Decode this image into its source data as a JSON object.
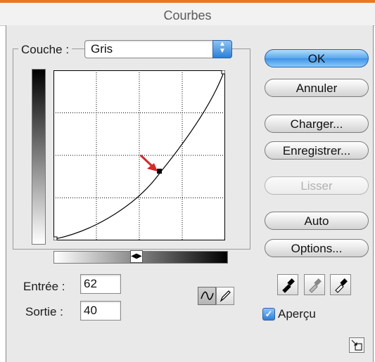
{
  "window": {
    "title": "Courbes"
  },
  "channel": {
    "label": "Couche :",
    "value": "Gris"
  },
  "fields": {
    "input_label": "Entrée :",
    "input_value": "62",
    "output_label": "Sortie :",
    "output_value": "40"
  },
  "buttons": {
    "ok": "OK",
    "cancel": "Annuler",
    "load": "Charger...",
    "save": "Enregistrer...",
    "smooth": "Lisser",
    "auto": "Auto",
    "options": "Options..."
  },
  "preview": {
    "label": "Aperçu",
    "checked": true
  },
  "colors": {
    "accent": "#3e93e6",
    "annotation_arrow": "#d42a2a",
    "title_strip": "#e87822"
  },
  "icons": [
    "curve-tool-icon",
    "pencil-tool-icon",
    "black-eyedropper-icon",
    "gray-eyedropper-icon",
    "white-eyedropper-icon",
    "expand-icon"
  ]
}
